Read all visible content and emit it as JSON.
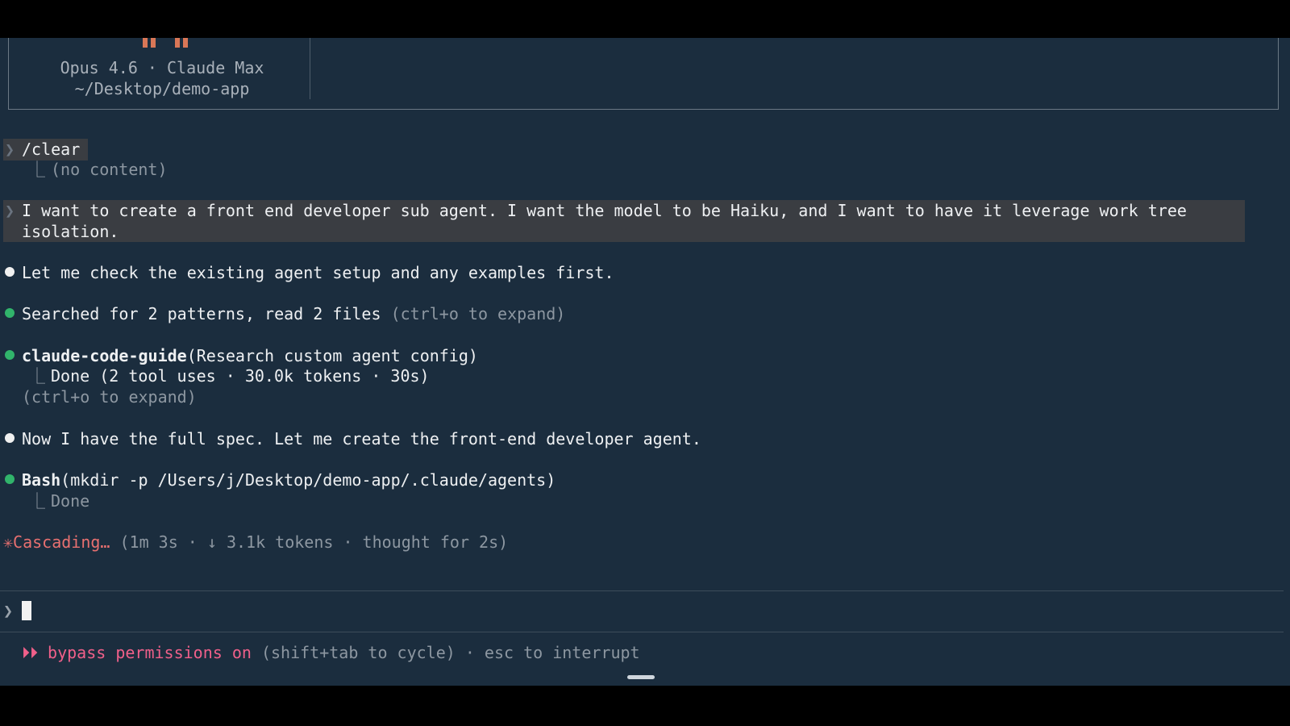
{
  "header": {
    "model_line": "Opus 4.6 · Claude Max",
    "path_line": "~/Desktop/demo-app"
  },
  "transcript": {
    "clear_cmd": "/clear",
    "clear_result": "(no content)",
    "user_msg_line1": "I want to create a front end developer sub agent. I want the model to be Haiku, and I want to have it leverage work tree",
    "user_msg_line2": "isolation.",
    "msg1": "Let me check the existing agent setup and any examples first.",
    "search_main": "Searched for 2 patterns, read 2 files",
    "search_hint": "(ctrl+o to expand)",
    "guide_tool": "claude-code-guide",
    "guide_args": "(Research custom agent config)",
    "guide_result": "Done (2 tool uses · 30.0k tokens · 30s)",
    "guide_hint": "(ctrl+o to expand)",
    "msg2": "Now I have the full spec. Let me create the front-end developer agent.",
    "bash_tool": "Bash",
    "bash_args": "(mkdir -p /Users/j/Desktop/demo-app/.claude/agents)",
    "bash_result": "Done"
  },
  "status": {
    "spinner_glyph": "✳",
    "verb": "Cascading…",
    "detail": "(1m 3s · ↓ 3.1k tokens · thought for 2s)"
  },
  "prompt": {
    "chevron": "❯",
    "value": ""
  },
  "footer": {
    "mode_icon": "⏵⏵",
    "mode_label": "bypass permissions on",
    "mode_hint": "(shift+tab to cycle) · esc to interrupt"
  },
  "colors": {
    "background": "#1b2d3e",
    "success_dot": "#31b46b",
    "spinner": "#e87070",
    "mode": "#f0608a",
    "logo": "#d97757"
  }
}
